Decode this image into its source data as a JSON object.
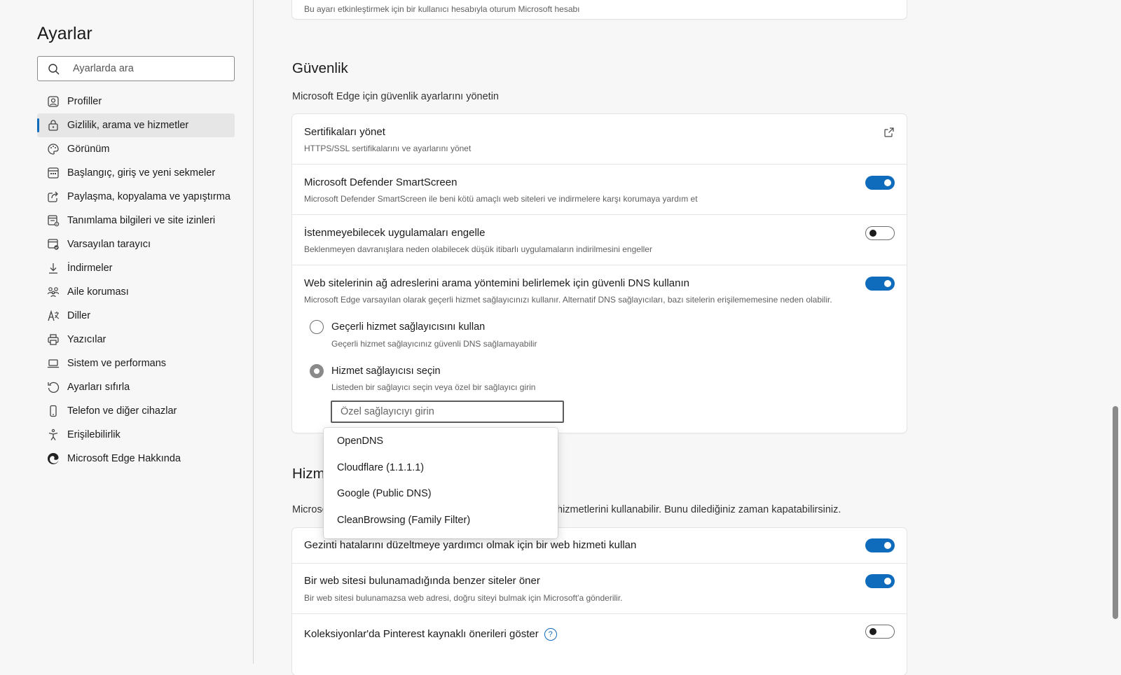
{
  "sidebar": {
    "title": "Ayarlar",
    "search_placeholder": "Ayarlarda ara",
    "items": [
      {
        "label": "Profiller",
        "icon": "profile-icon"
      },
      {
        "label": "Gizlilik, arama ve hizmetler",
        "icon": "lock-icon"
      },
      {
        "label": "Görünüm",
        "icon": "palette-icon"
      },
      {
        "label": "Başlangıç, giriş ve yeni sekmeler",
        "icon": "start-page-icon"
      },
      {
        "label": "Paylaşma, kopyalama ve yapıştırma",
        "icon": "share-icon"
      },
      {
        "label": "Tanımlama bilgileri ve site izinleri",
        "icon": "site-permissions-icon"
      },
      {
        "label": "Varsayılan tarayıcı",
        "icon": "default-browser-icon"
      },
      {
        "label": "İndirmeler",
        "icon": "download-icon"
      },
      {
        "label": "Aile koruması",
        "icon": "family-icon"
      },
      {
        "label": "Diller",
        "icon": "language-icon"
      },
      {
        "label": "Yazıcılar",
        "icon": "printer-icon"
      },
      {
        "label": "Sistem ve performans",
        "icon": "laptop-icon"
      },
      {
        "label": "Ayarları sıfırla",
        "icon": "reset-icon"
      },
      {
        "label": "Telefon ve diğer cihazlar",
        "icon": "phone-icon"
      },
      {
        "label": "Erişilebilirlik",
        "icon": "accessibility-icon"
      },
      {
        "label": "Microsoft Edge Hakkında",
        "icon": "edge-logo-icon"
      }
    ]
  },
  "top_card": {
    "desc": "Bu ayarı etkinleştirmek için bir kullanıcı hesabıyla oturum Microsoft hesabı"
  },
  "security": {
    "title": "Güvenlik",
    "desc": "Microsoft Edge için güvenlik ayarlarını yönetin",
    "certificates": {
      "title": "Sertifikaları yönet",
      "desc": "HTTPS/SSL sertifikalarını ve ayarlarını yönet"
    },
    "smartscreen": {
      "title": "Microsoft Defender SmartScreen",
      "desc": "Microsoft Defender SmartScreen ile beni kötü amaçlı web siteleri ve indirmelere karşı korumaya yardım et",
      "on": true
    },
    "pua": {
      "title": "İstenmeyebilecek uygulamaları engelle",
      "desc": "Beklenmeyen davranışlara neden olabilecek düşük itibarlı uygulamaların indirilmesini engeller",
      "on": false
    },
    "dns": {
      "title": "Web sitelerinin ağ adreslerini arama yöntemini belirlemek için güvenli DNS kullanın",
      "desc": "Microsoft Edge varsayılan olarak geçerli hizmet sağlayıcınızı kullanır. Alternatif DNS sağlayıcıları, bazı sitelerin erişilememesine neden olabilir.",
      "on": true,
      "option_current": {
        "title": "Geçerli hizmet sağlayıcısını kullan",
        "desc": "Geçerli hizmet sağlayıcınız güvenli DNS sağlamayabilir"
      },
      "option_choose": {
        "title": "Hizmet sağlayıcısı seçin",
        "desc": "Listeden bir sağlayıcı seçin veya özel bir sağlayıcı girin"
      },
      "input_placeholder": "Özel sağlayıcıyı girin",
      "dropdown_options": [
        "OpenDNS",
        "Cloudflare (1.1.1.1)",
        "Google (Public DNS)",
        "CleanBrowsing (Family Filter)"
      ]
    }
  },
  "services": {
    "title_visible": "Hizme",
    "desc_left": "Microsof",
    "desc_right": "hizmetlerini kullanabilir. Bunu dilediğiniz zaman kapatabilirsiniz.",
    "nav_errors": {
      "title": "Gezinti hatalarını düzeltmeye yardımcı olmak için bir web hizmeti kullan",
      "on": true
    },
    "similar_sites": {
      "title": "Bir web sitesi bulunamadığında benzer siteler öner",
      "desc": "Bir web sitesi bulunamazsa web adresi, doğru siteyi bulmak için Microsoft'a gönderilir.",
      "on": true
    },
    "pinterest": {
      "title": "Koleksiyonlar'da Pinterest kaynaklı önerileri göster",
      "help": "?",
      "on": false
    }
  }
}
